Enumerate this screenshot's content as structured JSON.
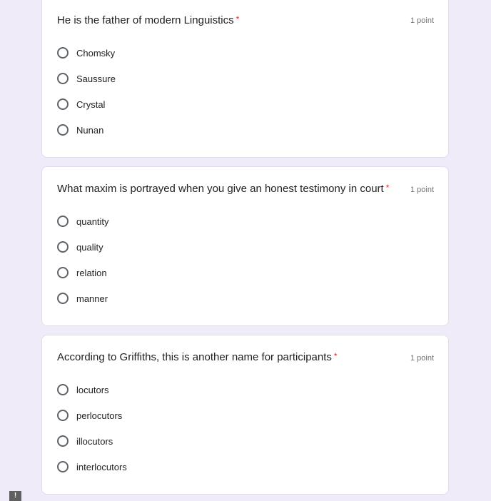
{
  "questions": [
    {
      "title": "He is the father of modern Linguistics",
      "required_mark": "*",
      "points": "1 point",
      "options": [
        "Chomsky",
        "Saussure",
        "Crystal",
        "Nunan"
      ]
    },
    {
      "title": "What maxim is portrayed when you give an honest testimony in court",
      "required_mark": "*",
      "points": "1 point",
      "options": [
        "quantity",
        "quality",
        "relation",
        "manner"
      ]
    },
    {
      "title": "According to Griffiths, this is another name for participants",
      "required_mark": "*",
      "points": "1 point",
      "options": [
        "locutors",
        "perlocutors",
        "illocutors",
        "interlocutors"
      ]
    }
  ],
  "footer": {
    "alert_icon": "!"
  }
}
